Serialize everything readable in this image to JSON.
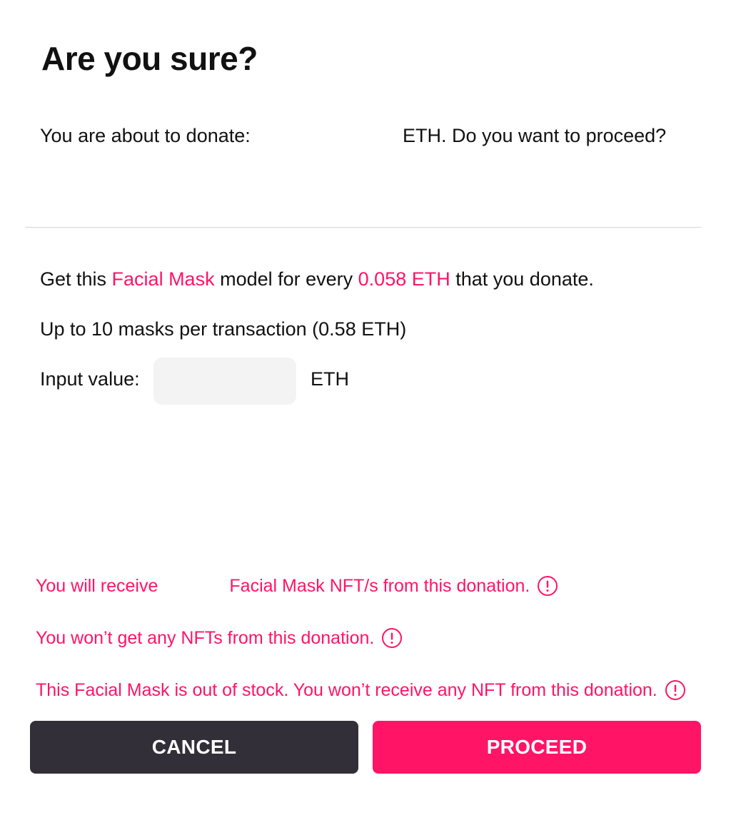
{
  "dialog": {
    "title": "Are you sure?",
    "summary": {
      "prefix": "You are about to donate:",
      "amount": "",
      "suffix": "ETH. Do you want to proceed?"
    },
    "offer": {
      "t1": "Get this ",
      "product": "Facial Mask",
      "t2": " model for every ",
      "price": "0.058 ETH",
      "t3": " that you donate."
    },
    "limit": "Up to 10 masks per transaction (0.58 ETH)",
    "input": {
      "label": "Input value:",
      "value": "",
      "placeholder": "",
      "unit": "ETH"
    },
    "warnings": {
      "receive": {
        "prefix": "You will receive",
        "count": "",
        "suffix": "Facial Mask NFT/s from this donation."
      },
      "none": "You won’t get any NFTs from this donation.",
      "out_of_stock": "This Facial Mask is out of stock. You won’t receive any NFT from this donation."
    },
    "buttons": {
      "cancel": "CANCEL",
      "proceed": "PROCEED"
    }
  },
  "colors": {
    "accent": "#ff1466",
    "cancel_bg": "#332f38",
    "input_bg": "#f3f3f3",
    "text": "#111111"
  },
  "icons": {
    "warning_info": "exclamation-circle-icon"
  }
}
